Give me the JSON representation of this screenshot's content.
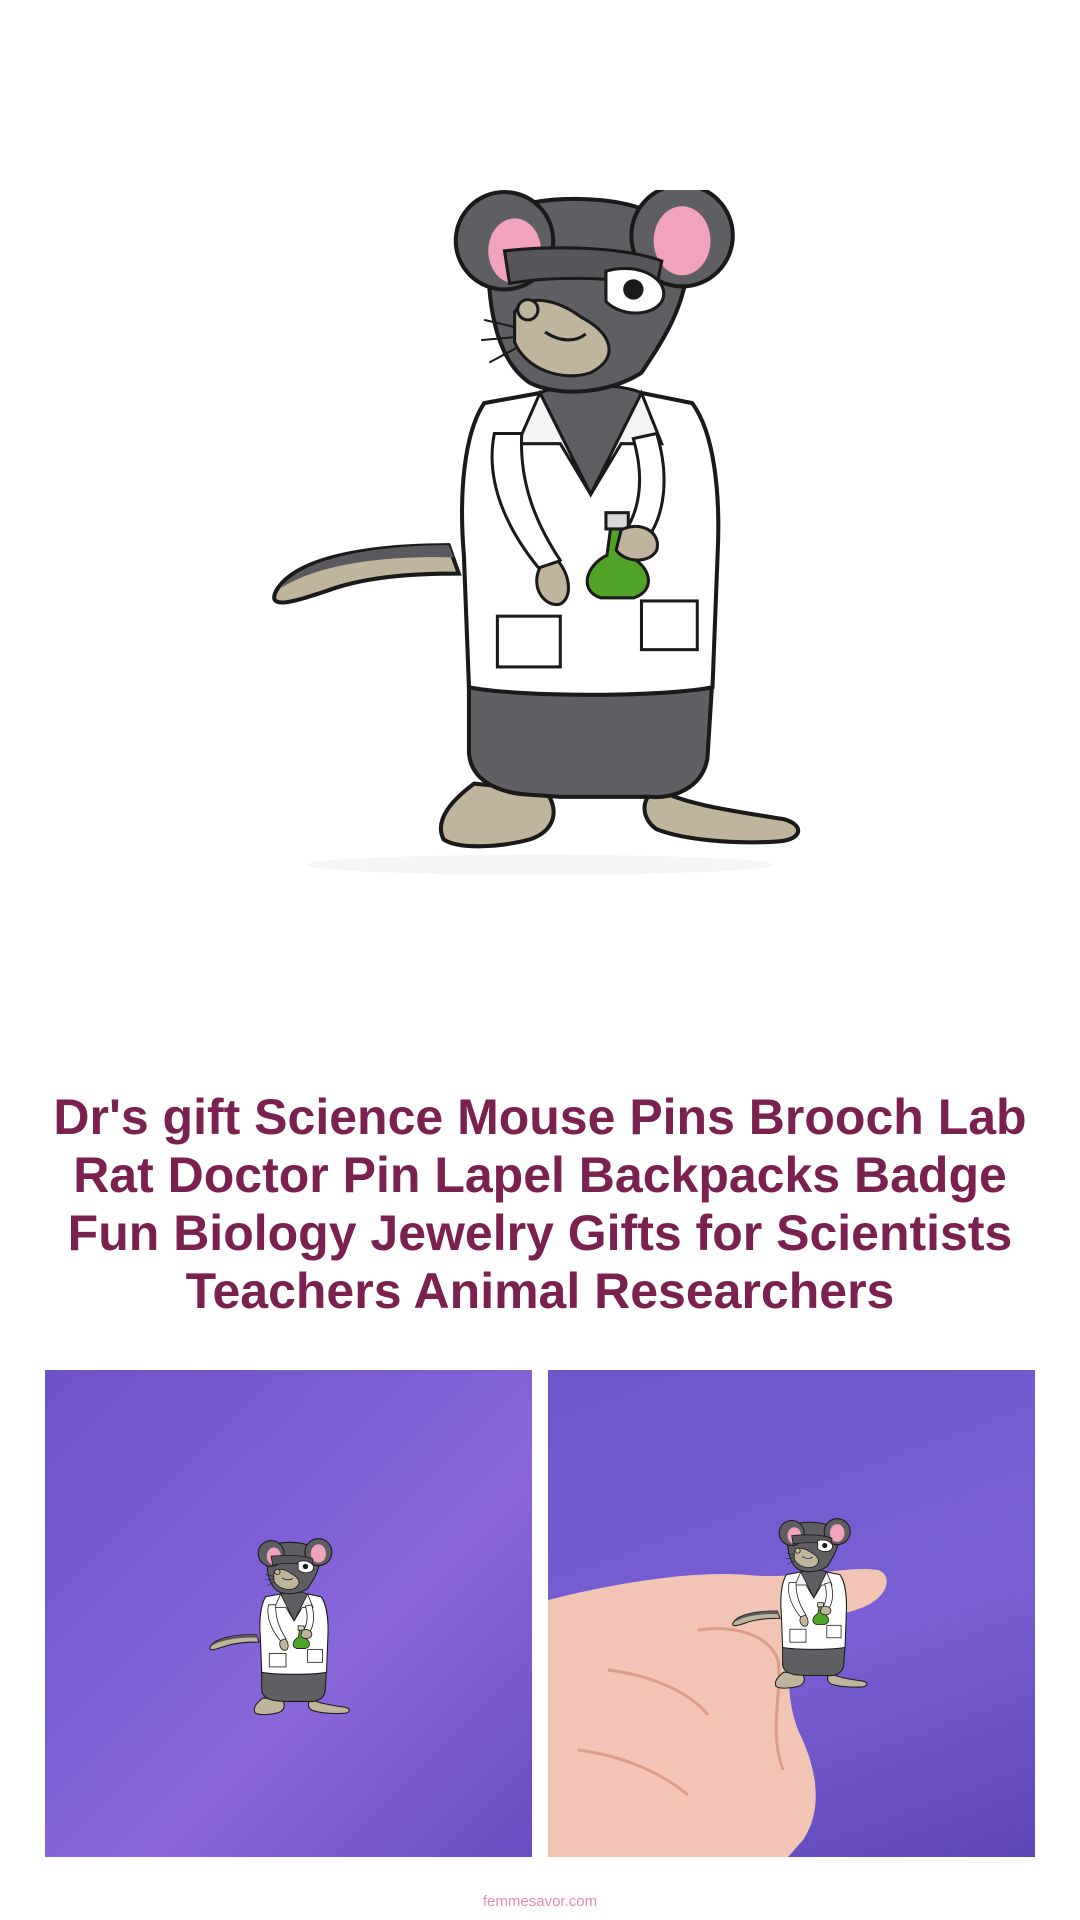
{
  "product": {
    "title": "Dr's gift Science Mouse Pins Brooch Lab Rat Doctor Pin Lapel Backpacks Badge Fun Biology Jewelry Gifts for Scientists Teachers Animal Researchers",
    "hero_image": "enamel-mouse-scientist-pin",
    "gallery": [
      {
        "image": "pin-on-purple-background"
      },
      {
        "image": "pin-held-in-hand-purple-background"
      }
    ]
  },
  "footer": {
    "site": "femmesavor.com"
  },
  "colors": {
    "title": "#7a2150",
    "footer": "#e98ab8",
    "background_purple": "#7b5cd3"
  }
}
